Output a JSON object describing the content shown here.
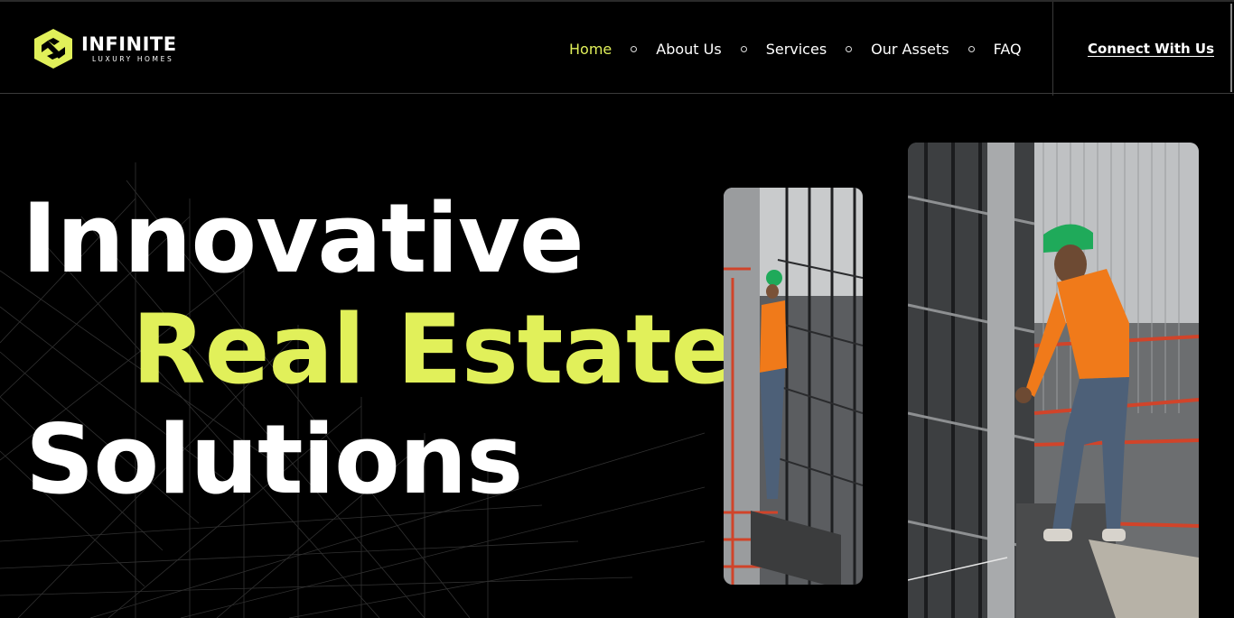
{
  "brand": {
    "name": "INFINITE",
    "tagline": "LUXURY HOMES",
    "logo_icon": "hexagon-infinity-logo-icon",
    "accent_color": "#e1f05a"
  },
  "nav": {
    "items": [
      {
        "label": "Home",
        "active": true
      },
      {
        "label": "About Us",
        "active": false
      },
      {
        "label": "Services",
        "active": false
      },
      {
        "label": "Our Assets",
        "active": false
      },
      {
        "label": "FAQ",
        "active": false
      }
    ],
    "separator_icon": "circle-dot-icon"
  },
  "cta": {
    "label": "Connect With Us"
  },
  "hero": {
    "line1": "Innovative",
    "line2": "Real Estate",
    "line3": "Solutions",
    "background": "wireframe-building-lines",
    "images": [
      {
        "name": "construction-worker-photo-small"
      },
      {
        "name": "construction-worker-photo-large"
      }
    ]
  },
  "colors": {
    "background": "#000000",
    "text": "#ffffff",
    "accent": "#e1f05a",
    "worker_shirt": "#f07a1a",
    "helmet": "#1faa5a"
  }
}
